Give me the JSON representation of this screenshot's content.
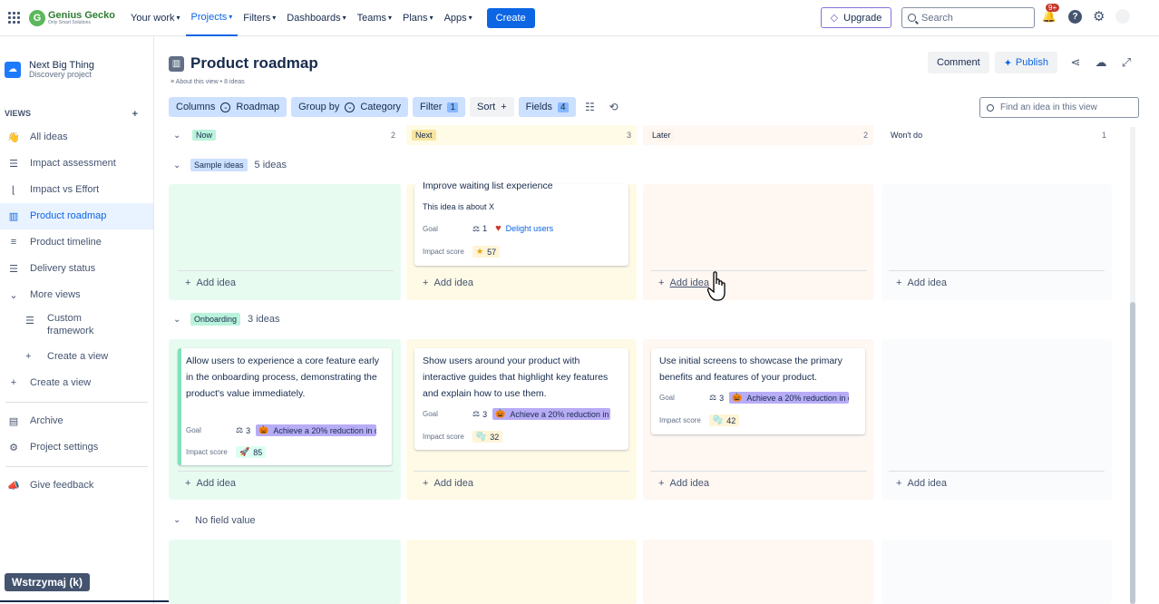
{
  "app": {
    "logo_name": "Genius Gecko",
    "logo_tagline": "Only Smart Solutions",
    "nav": [
      {
        "label": "Your work"
      },
      {
        "label": "Projects"
      },
      {
        "label": "Filters"
      },
      {
        "label": "Dashboards"
      },
      {
        "label": "Teams"
      },
      {
        "label": "Plans"
      },
      {
        "label": "Apps"
      }
    ],
    "create_label": "Create",
    "upgrade_label": "Upgrade",
    "search_placeholder": "Search",
    "notif_badge": "9+"
  },
  "sidebar": {
    "project_name": "Next Big Thing",
    "project_type": "Discovery project",
    "views_heading": "VIEWS",
    "views_add": "+",
    "items": [
      {
        "label": "All ideas"
      },
      {
        "label": "Impact assessment"
      },
      {
        "label": "Impact vs Effort"
      },
      {
        "label": "Product roadmap"
      },
      {
        "label": "Product timeline"
      },
      {
        "label": "Delivery status"
      },
      {
        "label": "More views"
      }
    ],
    "custom_framework": "Custom framework",
    "create_view_sub": "Create a view",
    "create_view": "Create a view",
    "archive": "Archive",
    "project_settings": "Project settings",
    "give_feedback": "Give feedback",
    "pause_tooltip": "Wstrzymaj (k)"
  },
  "main": {
    "title": "Product roadmap",
    "about": "About this view • 8 ideas",
    "comment": "Comment",
    "publish": "Publish",
    "toolbar": {
      "columns": "Columns",
      "columns_value": "Roadmap",
      "group_by": "Group by",
      "group_value": "Category",
      "filter": "Filter",
      "filter_count": "1",
      "sort": "Sort",
      "sort_plus": "+",
      "fields": "Fields",
      "fields_count": "4"
    },
    "find_placeholder": "Find an idea in this view",
    "columns": [
      {
        "label": "Now",
        "count": "2",
        "color": "#baf3db"
      },
      {
        "label": "Next",
        "count": "3",
        "color": "#f8e6a0"
      },
      {
        "label": "Later",
        "count": "2",
        "color": "#fff4ec"
      },
      {
        "label": "Won't do",
        "count": "1",
        "color": "#f7f8f9"
      }
    ],
    "add_idea": "Add idea",
    "groups": [
      {
        "label": "Sample ideas",
        "count": "5 ideas"
      },
      {
        "label": "Onboarding",
        "count": "3 ideas"
      },
      {
        "label": "No field value"
      }
    ],
    "field_labels": {
      "goal": "Goal",
      "impact": "Impact score"
    },
    "cards": {
      "sample_next": {
        "title": "Improve waiting list experience",
        "desc": "This idea is about X",
        "goal_count": "1",
        "goal": "Delight users",
        "score": "57"
      },
      "onb_now": {
        "title": "Allow users to experience a core feature early in the onboarding process, demonstrating the product's value immediately.",
        "goal_count": "3",
        "goal": "Achieve a 20% reduction in c",
        "score": "85"
      },
      "onb_next": {
        "title": "Show users around your product with interactive guides that highlight key features and explain how to use them.",
        "goal_count": "3",
        "goal": "Achieve a 20% reduction in c",
        "score": "32"
      },
      "onb_later": {
        "title": "Use initial screens to showcase the primary benefits and features of your product.",
        "goal_count": "3",
        "goal": "Achieve a 20% reduction in c",
        "score": "42"
      }
    }
  }
}
